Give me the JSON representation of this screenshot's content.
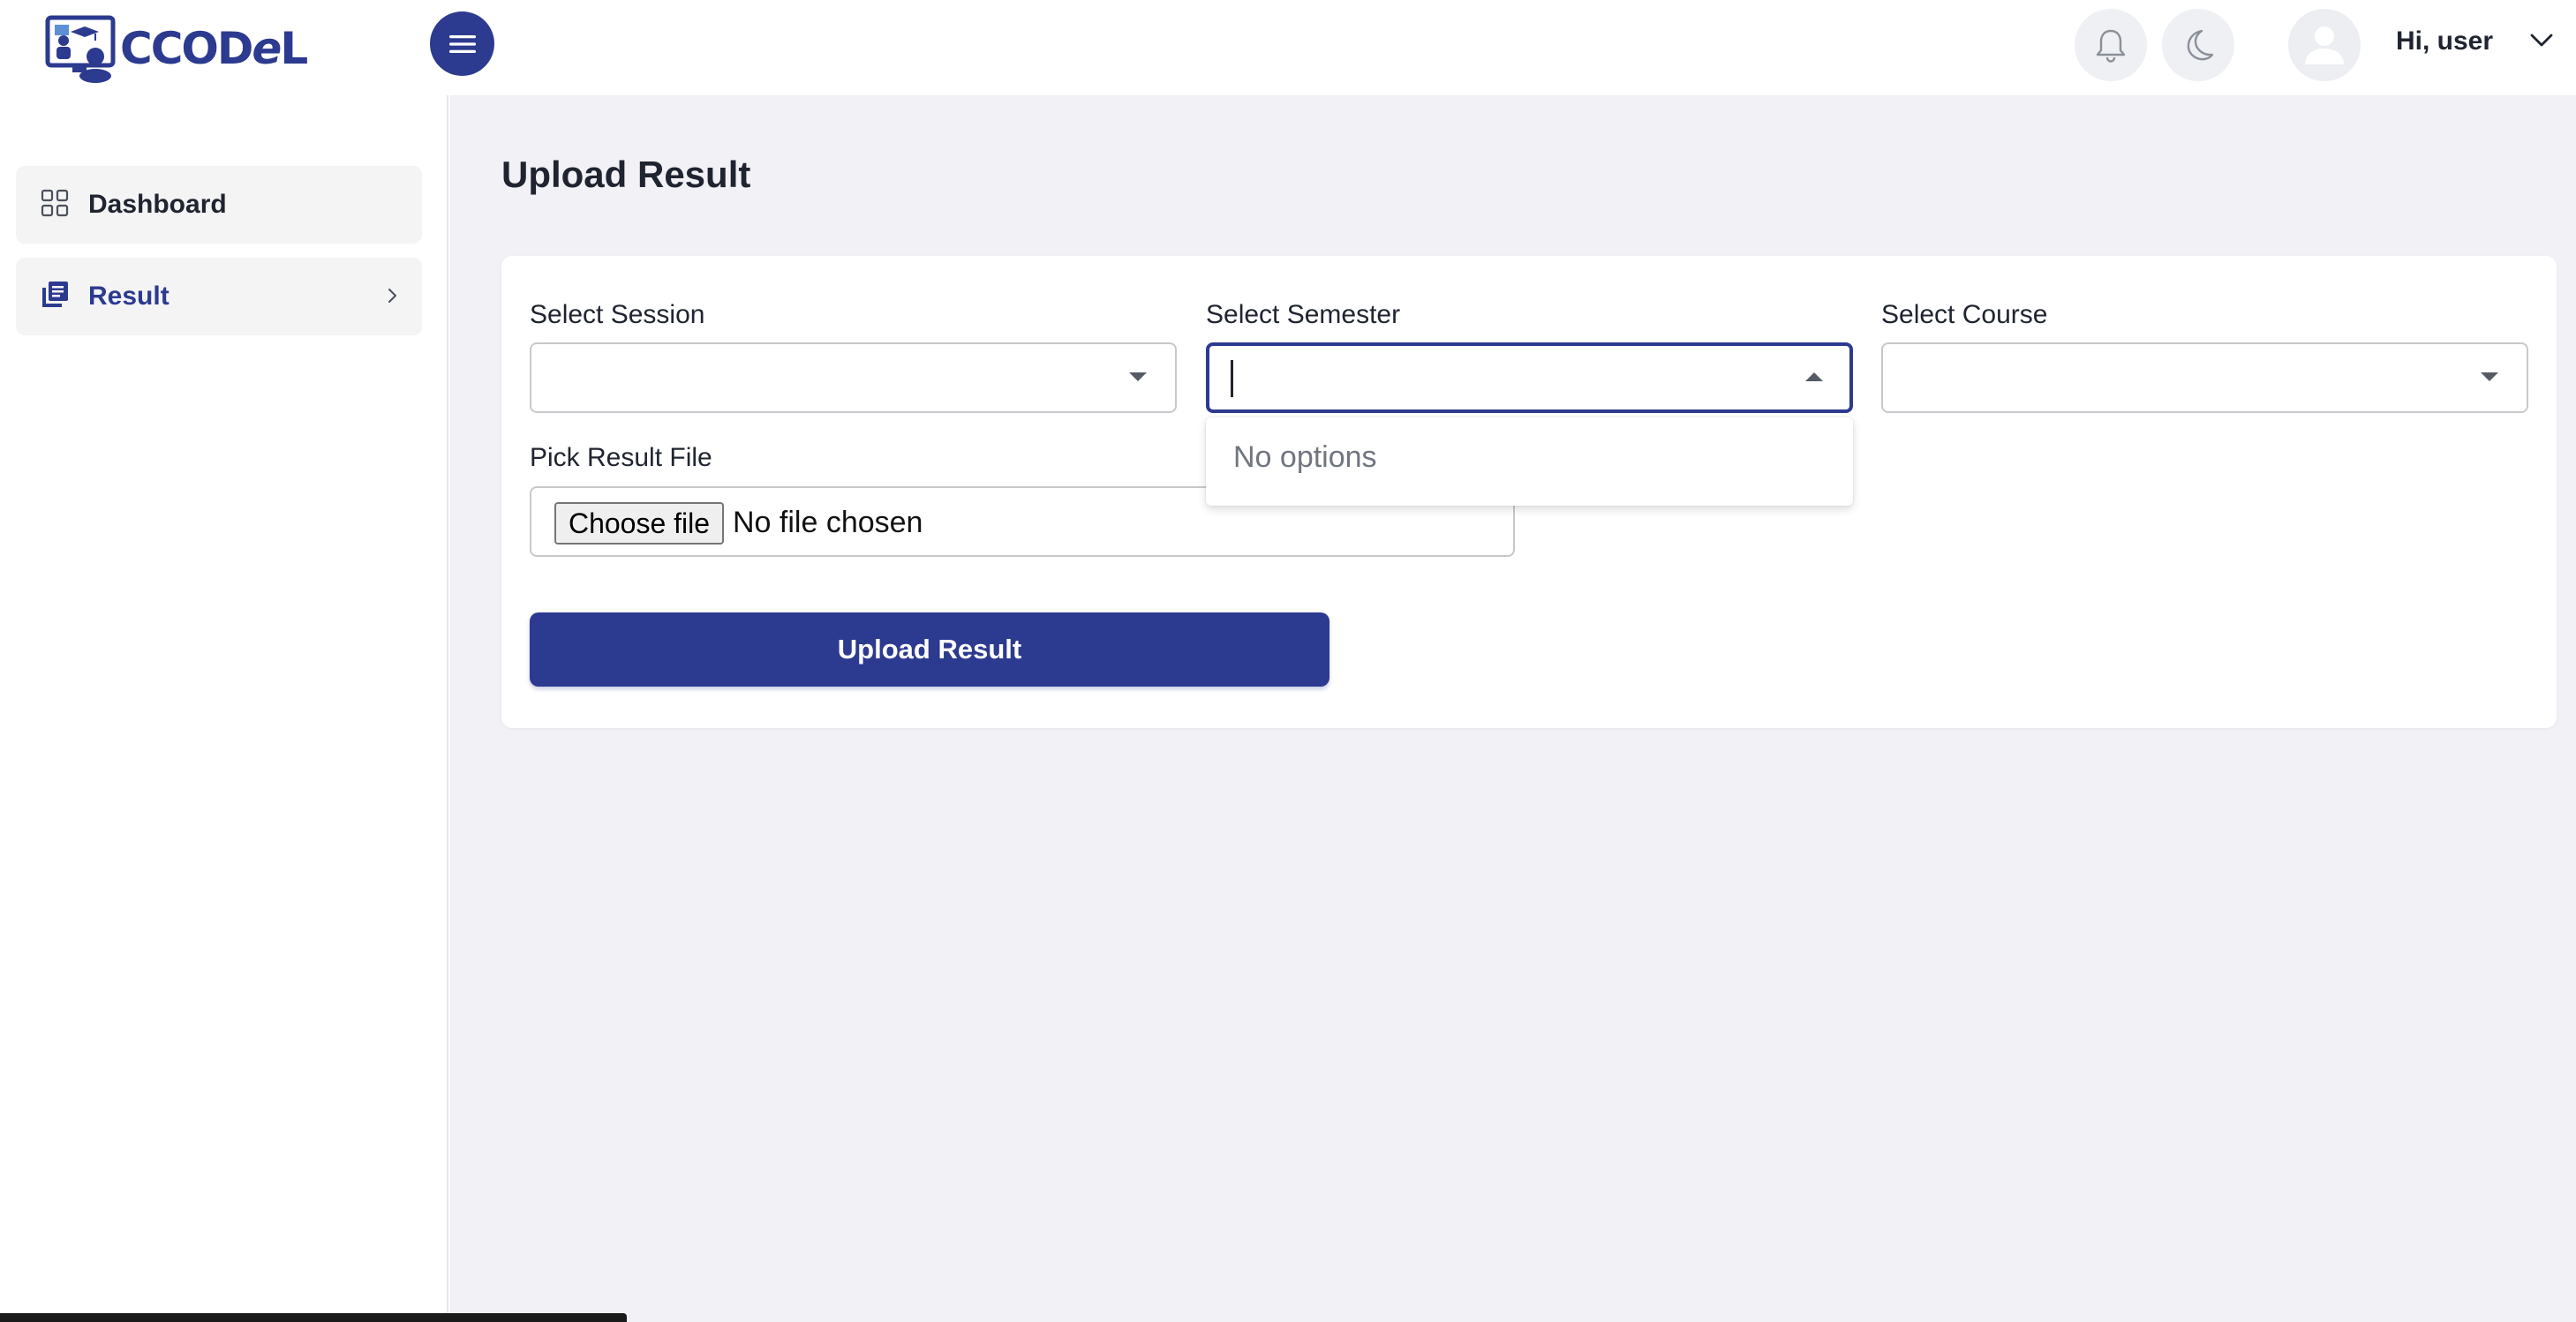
{
  "brand": {
    "logo_text_before": "CCOD",
    "logo_text_e": "e",
    "logo_text_after": "L"
  },
  "header": {
    "user_greeting": "Hi, user",
    "icons": [
      "menu-icon",
      "bell-icon",
      "moon-icon",
      "user-icon",
      "chevron-down-icon"
    ]
  },
  "sidebar": {
    "items": [
      {
        "label": "Dashboard",
        "icon": "grid-icon"
      },
      {
        "label": "Result",
        "icon": "library-books-icon",
        "active": true
      }
    ]
  },
  "main": {
    "title": "Upload Result",
    "form": {
      "session_label": "Select Session",
      "semester_label": "Select Semester",
      "course_label": "Select Course",
      "file_label": "Pick Result File",
      "file_button": "Choose file",
      "file_status": "No file chosen",
      "dropdown_message": "No options",
      "submit_label": "Upload Result"
    }
  },
  "colors": {
    "accent": "#2c3a8f",
    "background": "#f1f1f6",
    "card": "#ffffff"
  }
}
